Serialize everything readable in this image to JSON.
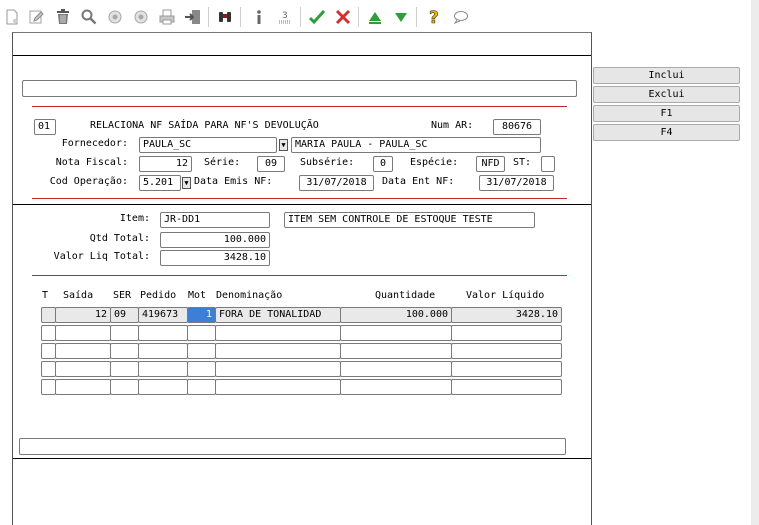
{
  "toolbar": {
    "icons": [
      "new-document-icon",
      "edit-pencil-icon",
      "trash-icon",
      "search-icon",
      "previous-record-icon",
      "next-record-icon",
      "print-icon",
      "exit-door-icon",
      "binoculars-icon",
      "info-icon",
      "numbered-list-icon",
      "confirm-check-icon",
      "cancel-x-icon",
      "arrow-up-icon",
      "arrow-down-icon",
      "help-question-icon",
      "comment-bubble-icon"
    ],
    "colors": {
      "check": "#2e9e3a",
      "cancel": "#d32f2f",
      "up": "#2e9e3a",
      "down": "#2e9e3a",
      "help": "#f2b200"
    }
  },
  "side_buttons": {
    "inclui": "Inclui",
    "exclui": "Exclui",
    "f1": "F1",
    "f4": "F4"
  },
  "header": {
    "code": "01",
    "title": "RELACIONA NF SAÍDA PARA NF'S DEVOLUÇÃO",
    "num_ar_label": "Num AR:",
    "num_ar": "80676",
    "fornecedor_label": "Fornecedor:",
    "fornecedor_code": "PAULA_SC",
    "fornecedor_name": "MARIA PAULA - PAULA_SC",
    "nota_label": "Nota Fiscal:",
    "nota": "12",
    "serie_label": "Série:",
    "serie": "09",
    "subserie_label": "Subsérie:",
    "subserie": "0",
    "especie_label": "Espécie:",
    "especie": "NFD",
    "st_label": "ST:",
    "st": "",
    "cod_op_label": "Cod Operação:",
    "cod_op": "5.201",
    "data_emis_label": "Data Emis NF:",
    "data_emis": "31/07/2018",
    "data_ent_label": "Data Ent NF:",
    "data_ent": "31/07/2018"
  },
  "item": {
    "item_label": "Item:",
    "item_code": "JR-DD1",
    "item_desc": "ITEM SEM CONTROLE DE ESTOQUE TESTE",
    "qtd_label": "Qtd Total:",
    "qtd": "100.000",
    "valor_label": "Valor Liq Total:",
    "valor": "3428.10"
  },
  "grid": {
    "headers": {
      "t": "T",
      "saida": "Saída",
      "ser": "SER",
      "pedido": "Pedido",
      "mot": "Mot",
      "denominacao": "Denominação",
      "quantidade": "Quantidade",
      "valor": "Valor Líquido"
    },
    "rows": [
      {
        "t": "",
        "saida": "12",
        "ser": "09",
        "pedido": "419673",
        "mot": "1",
        "denominacao": "FORA DE TONALIDAD",
        "quantidade": "100.000",
        "valor": "3428.10"
      },
      {
        "t": "",
        "saida": "",
        "ser": "",
        "pedido": "",
        "mot": "",
        "denominacao": "",
        "quantidade": "",
        "valor": ""
      },
      {
        "t": "",
        "saida": "",
        "ser": "",
        "pedido": "",
        "mot": "",
        "denominacao": "",
        "quantidade": "",
        "valor": ""
      },
      {
        "t": "",
        "saida": "",
        "ser": "",
        "pedido": "",
        "mot": "",
        "denominacao": "",
        "quantidade": "",
        "valor": ""
      },
      {
        "t": "",
        "saida": "",
        "ser": "",
        "pedido": "",
        "mot": "",
        "denominacao": "",
        "quantidade": "",
        "valor": ""
      }
    ]
  },
  "message_bar": {
    "top": "",
    "bottom": ""
  }
}
